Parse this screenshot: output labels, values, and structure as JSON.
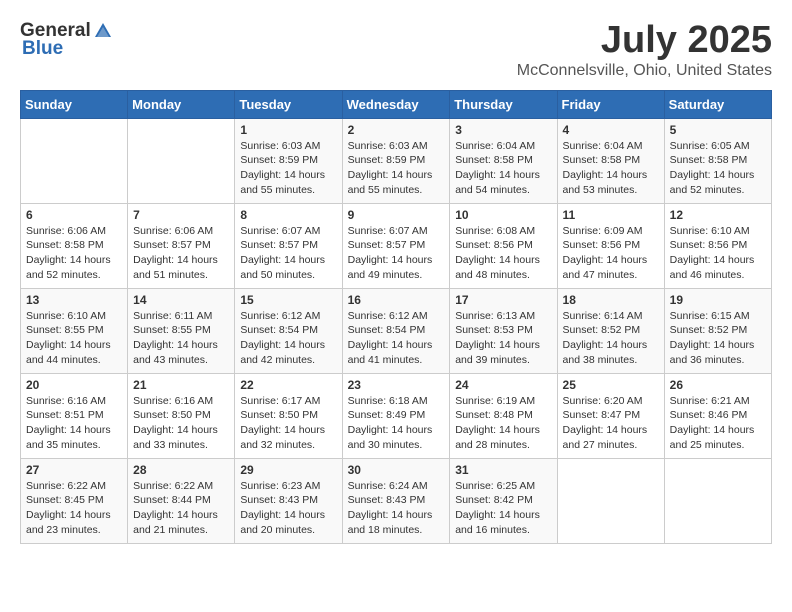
{
  "header": {
    "logo_general": "General",
    "logo_blue": "Blue",
    "month": "July 2025",
    "location": "McConnelsville, Ohio, United States"
  },
  "weekdays": [
    "Sunday",
    "Monday",
    "Tuesday",
    "Wednesday",
    "Thursday",
    "Friday",
    "Saturday"
  ],
  "weeks": [
    [
      {
        "day": "",
        "info": ""
      },
      {
        "day": "",
        "info": ""
      },
      {
        "day": "1",
        "info": "Sunrise: 6:03 AM\nSunset: 8:59 PM\nDaylight: 14 hours and 55 minutes."
      },
      {
        "day": "2",
        "info": "Sunrise: 6:03 AM\nSunset: 8:59 PM\nDaylight: 14 hours and 55 minutes."
      },
      {
        "day": "3",
        "info": "Sunrise: 6:04 AM\nSunset: 8:58 PM\nDaylight: 14 hours and 54 minutes."
      },
      {
        "day": "4",
        "info": "Sunrise: 6:04 AM\nSunset: 8:58 PM\nDaylight: 14 hours and 53 minutes."
      },
      {
        "day": "5",
        "info": "Sunrise: 6:05 AM\nSunset: 8:58 PM\nDaylight: 14 hours and 52 minutes."
      }
    ],
    [
      {
        "day": "6",
        "info": "Sunrise: 6:06 AM\nSunset: 8:58 PM\nDaylight: 14 hours and 52 minutes."
      },
      {
        "day": "7",
        "info": "Sunrise: 6:06 AM\nSunset: 8:57 PM\nDaylight: 14 hours and 51 minutes."
      },
      {
        "day": "8",
        "info": "Sunrise: 6:07 AM\nSunset: 8:57 PM\nDaylight: 14 hours and 50 minutes."
      },
      {
        "day": "9",
        "info": "Sunrise: 6:07 AM\nSunset: 8:57 PM\nDaylight: 14 hours and 49 minutes."
      },
      {
        "day": "10",
        "info": "Sunrise: 6:08 AM\nSunset: 8:56 PM\nDaylight: 14 hours and 48 minutes."
      },
      {
        "day": "11",
        "info": "Sunrise: 6:09 AM\nSunset: 8:56 PM\nDaylight: 14 hours and 47 minutes."
      },
      {
        "day": "12",
        "info": "Sunrise: 6:10 AM\nSunset: 8:56 PM\nDaylight: 14 hours and 46 minutes."
      }
    ],
    [
      {
        "day": "13",
        "info": "Sunrise: 6:10 AM\nSunset: 8:55 PM\nDaylight: 14 hours and 44 minutes."
      },
      {
        "day": "14",
        "info": "Sunrise: 6:11 AM\nSunset: 8:55 PM\nDaylight: 14 hours and 43 minutes."
      },
      {
        "day": "15",
        "info": "Sunrise: 6:12 AM\nSunset: 8:54 PM\nDaylight: 14 hours and 42 minutes."
      },
      {
        "day": "16",
        "info": "Sunrise: 6:12 AM\nSunset: 8:54 PM\nDaylight: 14 hours and 41 minutes."
      },
      {
        "day": "17",
        "info": "Sunrise: 6:13 AM\nSunset: 8:53 PM\nDaylight: 14 hours and 39 minutes."
      },
      {
        "day": "18",
        "info": "Sunrise: 6:14 AM\nSunset: 8:52 PM\nDaylight: 14 hours and 38 minutes."
      },
      {
        "day": "19",
        "info": "Sunrise: 6:15 AM\nSunset: 8:52 PM\nDaylight: 14 hours and 36 minutes."
      }
    ],
    [
      {
        "day": "20",
        "info": "Sunrise: 6:16 AM\nSunset: 8:51 PM\nDaylight: 14 hours and 35 minutes."
      },
      {
        "day": "21",
        "info": "Sunrise: 6:16 AM\nSunset: 8:50 PM\nDaylight: 14 hours and 33 minutes."
      },
      {
        "day": "22",
        "info": "Sunrise: 6:17 AM\nSunset: 8:50 PM\nDaylight: 14 hours and 32 minutes."
      },
      {
        "day": "23",
        "info": "Sunrise: 6:18 AM\nSunset: 8:49 PM\nDaylight: 14 hours and 30 minutes."
      },
      {
        "day": "24",
        "info": "Sunrise: 6:19 AM\nSunset: 8:48 PM\nDaylight: 14 hours and 28 minutes."
      },
      {
        "day": "25",
        "info": "Sunrise: 6:20 AM\nSunset: 8:47 PM\nDaylight: 14 hours and 27 minutes."
      },
      {
        "day": "26",
        "info": "Sunrise: 6:21 AM\nSunset: 8:46 PM\nDaylight: 14 hours and 25 minutes."
      }
    ],
    [
      {
        "day": "27",
        "info": "Sunrise: 6:22 AM\nSunset: 8:45 PM\nDaylight: 14 hours and 23 minutes."
      },
      {
        "day": "28",
        "info": "Sunrise: 6:22 AM\nSunset: 8:44 PM\nDaylight: 14 hours and 21 minutes."
      },
      {
        "day": "29",
        "info": "Sunrise: 6:23 AM\nSunset: 8:43 PM\nDaylight: 14 hours and 20 minutes."
      },
      {
        "day": "30",
        "info": "Sunrise: 6:24 AM\nSunset: 8:43 PM\nDaylight: 14 hours and 18 minutes."
      },
      {
        "day": "31",
        "info": "Sunrise: 6:25 AM\nSunset: 8:42 PM\nDaylight: 14 hours and 16 minutes."
      },
      {
        "day": "",
        "info": ""
      },
      {
        "day": "",
        "info": ""
      }
    ]
  ]
}
